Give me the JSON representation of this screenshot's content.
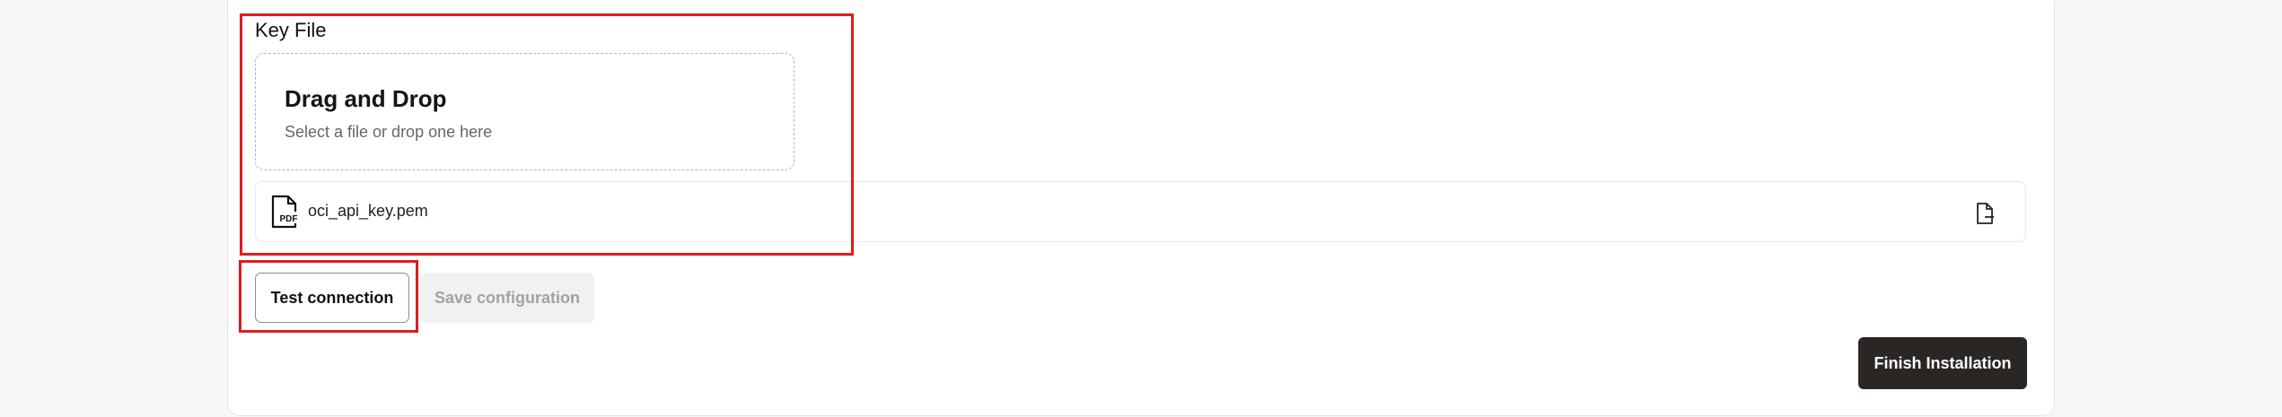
{
  "key_file": {
    "label": "Key File"
  },
  "dropzone": {
    "title": "Drag and Drop",
    "subtitle": "Select a file or drop one here"
  },
  "file": {
    "name": "oci_api_key.pem",
    "icon": "pdf-file-icon",
    "icon_text": "PDF",
    "action_icon": "file-remove-icon"
  },
  "buttons": {
    "test_connection": "Test connection",
    "save_configuration": "Save configuration",
    "finish_installation": "Finish Installation"
  },
  "colors": {
    "highlight": "#e01b1b",
    "primary_button": "#2a2624",
    "disabled_button_bg": "#f1f1f1",
    "disabled_button_text": "#a2a2a2"
  }
}
